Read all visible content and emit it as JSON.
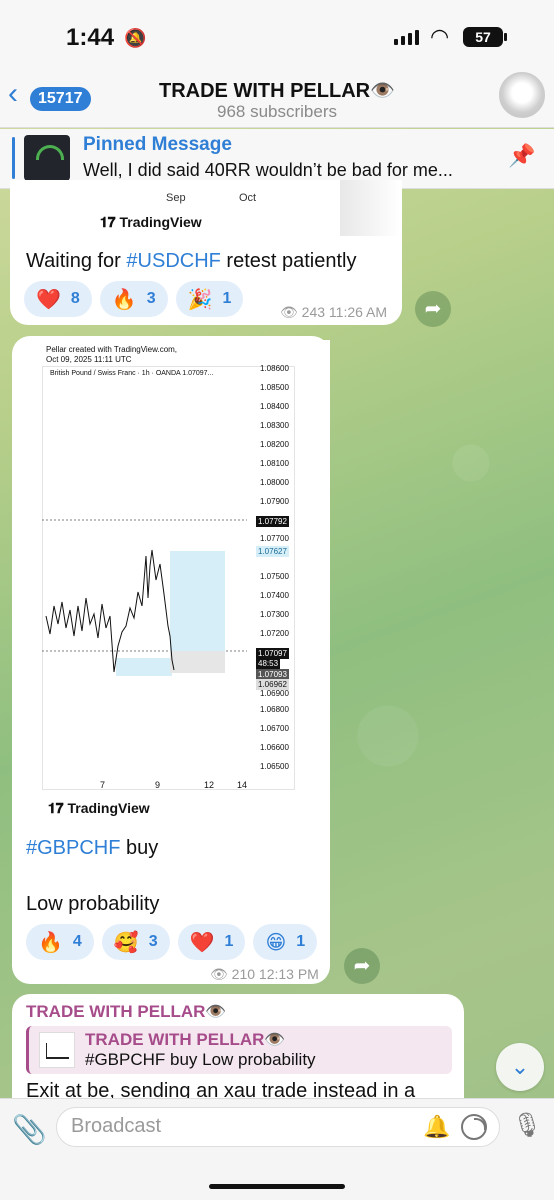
{
  "status": {
    "time": "1:44",
    "battery": "57"
  },
  "header": {
    "back_count": "15717",
    "title": "TRADE WITH PELLAR👁️",
    "subtitle": "968 subscribers"
  },
  "pinned": {
    "title": "Pinned Message",
    "text": "Well, I did said 40RR wouldn’t be bad for me..."
  },
  "messages": [
    {
      "chart_labels": {
        "x1": "Sep",
        "x2": "Oct",
        "brand": "TradingView"
      },
      "text_prefix": "Waiting for ",
      "tag": "#USDCHF",
      "text_suffix": " retest patiently",
      "reactions": [
        {
          "emoji": "❤️",
          "count": "8"
        },
        {
          "emoji": "🔥",
          "count": "3"
        },
        {
          "emoji": "🎉",
          "count": "1"
        }
      ],
      "views": "243",
      "time": "11:26 AM"
    },
    {
      "chart": {
        "header_line1": "Pellar created with TradingView.com,",
        "header_line2": "Oct 09, 2025 11:11 UTC",
        "symbol": "British Pound / Swiss Franc · 1h · OANDA  1.07097...",
        "y_ticks": [
          "1.08600",
          "1.08500",
          "1.08400",
          "1.08300",
          "1.08200",
          "1.08100",
          "1.08000",
          "1.07900",
          "1.07700",
          "1.07500",
          "1.07400",
          "1.07300",
          "1.07200",
          "1.06900",
          "1.06800",
          "1.06700",
          "1.06600",
          "1.06500"
        ],
        "price_labels": {
          "target": "1.07792",
          "entry_top": "1.07627",
          "current": "1.07097",
          "countdown": "48:53",
          "current2": "1.07093",
          "stop": "1.06962"
        },
        "x_ticks": [
          "7",
          "9",
          "12",
          "14"
        ],
        "brand": "TradingView"
      },
      "tag": "#GBPCHF",
      "text_suffix": " buy",
      "line2": "Low probability",
      "reactions": [
        {
          "emoji": "🔥",
          "count": "4"
        },
        {
          "emoji": "🥰",
          "count": "3"
        },
        {
          "emoji": "❤️",
          "count": "1"
        },
        {
          "emoji": "😁",
          "count": "1"
        }
      ],
      "views": "210",
      "time": "12:13 PM"
    },
    {
      "author": "TRADE WITH PELLAR👁️",
      "quote_author": "TRADE WITH PELLAR👁️",
      "quote_text": "#GBPCHF buy Low probability",
      "text": "Exit at be, sending an xau trade instead in a"
    }
  ],
  "input": {
    "placeholder": "Broadcast"
  },
  "icons": {
    "back": "chevron-left-icon",
    "muted": "bell-slash-icon",
    "pin": "pin-list-icon",
    "forward": "share-arrow-icon",
    "views": "eye-icon",
    "attach": "paperclip-icon",
    "notify": "bell-icon",
    "timer": "timer-icon",
    "mic": "microphone-icon",
    "scroll": "chevron-down-icon"
  }
}
